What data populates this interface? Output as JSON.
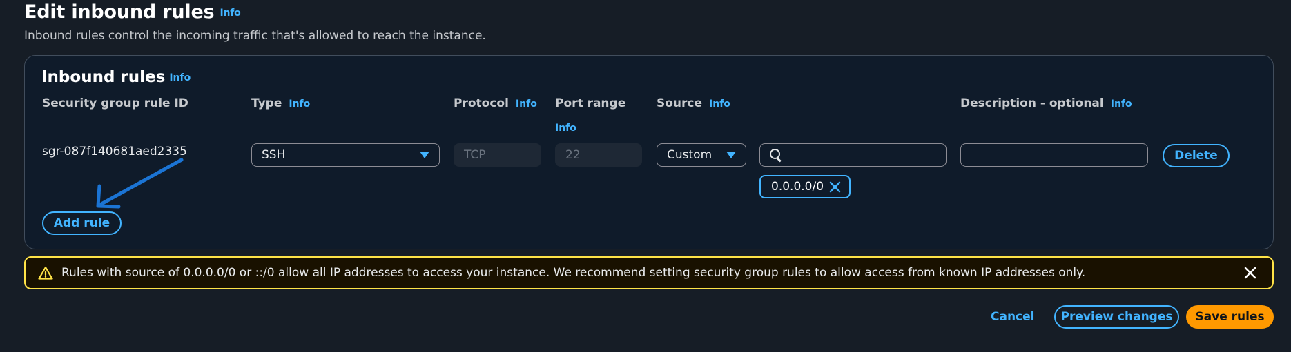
{
  "header": {
    "title": "Edit inbound rules",
    "info": "Info",
    "subtitle": "Inbound rules control the incoming traffic that's allowed to reach the instance."
  },
  "panel": {
    "title": "Inbound rules",
    "info": "Info",
    "columns": {
      "rule_id": "Security group rule ID",
      "type": "Type",
      "protocol": "Protocol",
      "port_range": "Port range",
      "source": "Source",
      "description": "Description - optional"
    },
    "info_label": "Info"
  },
  "rule": {
    "id": "sgr-087f140681aed2335",
    "type": "SSH",
    "protocol": "TCP",
    "port_range": "22",
    "source_mode": "Custom",
    "source_search_value": "",
    "source_token": "0.0.0.0/0",
    "description": "",
    "delete_label": "Delete"
  },
  "add_rule_label": "Add rule",
  "warning": {
    "text": "Rules with source of 0.0.0.0/0 or ::/0 allow all IP addresses to access your instance. We recommend setting security group rules to allow access from known IP addresses only."
  },
  "footer": {
    "cancel_label": "Cancel",
    "preview_label": "Preview changes",
    "save_label": "Save rules"
  },
  "icons": {
    "search": "search-icon",
    "dropdown": "caret-down-icon",
    "token_remove": "close-icon",
    "warning": "warning-icon",
    "dismiss": "close-icon",
    "annotation": "arrow-annotation-icon"
  },
  "colors": {
    "accent": "#42b4ff",
    "primary_button": "#ff9900",
    "warning_border": "#ffe347",
    "background": "#161d26",
    "panel": "#0f1b2a"
  }
}
